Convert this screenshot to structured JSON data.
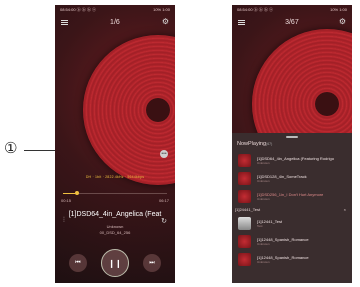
{
  "callout": {
    "marker": "①"
  },
  "left": {
    "status_left": "08:54:00 ⓑ ⓑ ⓑ ⓐ",
    "status_right": "10% 1:00",
    "track_position": "1/6",
    "format_info": "DH · 1bit · 2822.4kHz · 5644kbps",
    "time_current": "00:15",
    "time_duration": "06:17",
    "progress": 0.12,
    "title": "[1]DSD64_4in_Angelica (Feat",
    "artist": "Unknown",
    "album": "00_DSD_64_256",
    "prev_label": "⏮",
    "play_label": "❙❙",
    "next_label": "⏭"
  },
  "right": {
    "status_left": "08:54:00 ⓑ ⓑ ⓑ ⓐ",
    "status_right": "10% 1:00",
    "track_position": "3/67",
    "now_playing_title": "NowPlaying",
    "now_playing_count": "(67)",
    "items": [
      {
        "title": "[1]DSD64_4in_Angelica (Featuring Rodrigo",
        "subtitle": "Unknown",
        "active": false
      },
      {
        "title": "[1]DSD128_4in_SomeTrack",
        "subtitle": "Unknown",
        "active": false
      },
      {
        "title": "[1]DSD256_1in_I Don't Hurt Anymore",
        "subtitle": "Unknown",
        "active": true
      }
    ],
    "group_label": "[1]24441_Test",
    "group_close": "×",
    "items2": [
      {
        "title": "[1]12441_Test",
        "subtitle": "Test"
      },
      {
        "title": "[1]12448_Spanish_Romance",
        "subtitle": "Unknown"
      },
      {
        "title": "[1]12448_Spanish_Romance",
        "subtitle": "Unknown"
      }
    ]
  }
}
